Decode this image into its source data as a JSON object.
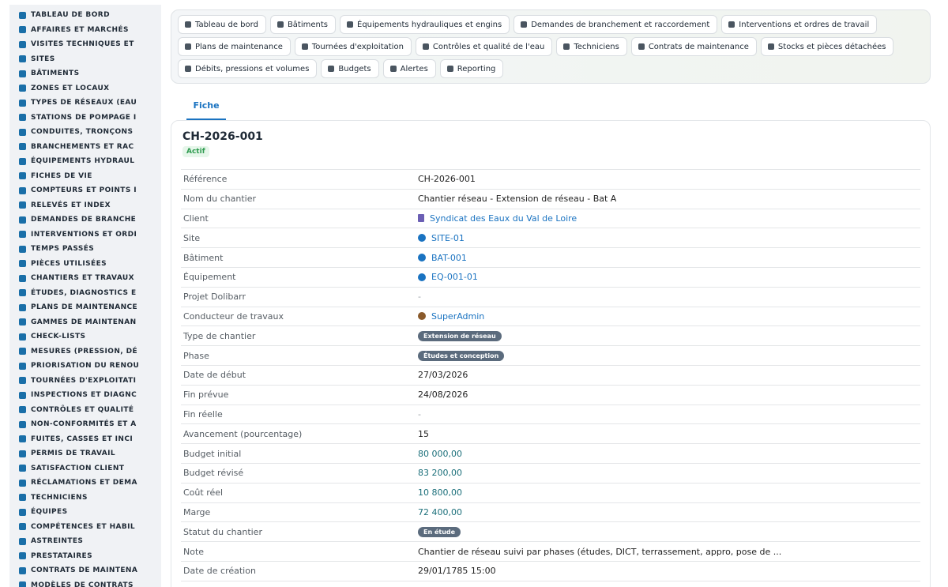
{
  "sidebar": {
    "items": [
      {
        "label": "TABLEAU DE BORD",
        "icon": "dashboard-icon"
      },
      {
        "label": "AFFAIRES ET MARCHÉS",
        "icon": "briefcase-icon"
      },
      {
        "label": "VISITES TECHNIQUES ET",
        "icon": "clipboard-icon"
      },
      {
        "label": "SITES",
        "icon": "map-pin-icon"
      },
      {
        "label": "BÂTIMENTS",
        "icon": "building-icon"
      },
      {
        "label": "ZONES ET LOCAUX",
        "icon": "layers-icon"
      },
      {
        "label": "TYPES DE RÉSEAUX (EAU",
        "icon": "network-icon"
      },
      {
        "label": "STATIONS DE POMPAGE I",
        "icon": "pump-icon"
      },
      {
        "label": "CONDUITES, TRONÇONS",
        "icon": "pipe-icon"
      },
      {
        "label": "BRANCHEMENTS ET RAC",
        "icon": "connection-icon"
      },
      {
        "label": "ÉQUIPEMENTS HYDRAUL",
        "icon": "gears-icon"
      },
      {
        "label": "FICHES DE VIE",
        "icon": "history-icon"
      },
      {
        "label": "COMPTEURS ET POINTS I",
        "icon": "gauge-icon"
      },
      {
        "label": "RELEVÉS ET INDEX",
        "icon": "list-icon"
      },
      {
        "label": "DEMANDES DE BRANCHE",
        "icon": "question-icon"
      },
      {
        "label": "INTERVENTIONS ET ORDI",
        "icon": "task-icon"
      },
      {
        "label": "TEMPS PASSÉS",
        "icon": "clock-icon"
      },
      {
        "label": "PIÈCES UTILISÉES",
        "icon": "parts-icon"
      },
      {
        "label": "CHANTIERS ET TRAVAUX",
        "icon": "hammer-icon"
      },
      {
        "label": "ÉTUDES, DIAGNOSTICS E",
        "icon": "book-icon"
      },
      {
        "label": "PLANS DE MAINTENANCE",
        "icon": "calendar-icon"
      },
      {
        "label": "GAMMES DE MAINTENAN",
        "icon": "list-ordered-icon"
      },
      {
        "label": "CHECK-LISTS",
        "icon": "checklist-icon"
      },
      {
        "label": "MESURES (PRESSION, DÉ",
        "icon": "thermometer-icon"
      },
      {
        "label": "PRIORISATION DU RENOU",
        "icon": "chart-icon"
      },
      {
        "label": "TOURNÉES D'EXPLOITATI",
        "icon": "route-icon"
      },
      {
        "label": "INSPECTIONS ET DIAGNC",
        "icon": "search-icon"
      },
      {
        "label": "CONTRÔLES ET QUALITÉ",
        "icon": "clipboard-check-icon"
      },
      {
        "label": "NON-CONFORMITÉS ET A",
        "icon": "alert-circle-icon"
      },
      {
        "label": "FUITES, CASSES ET INCI",
        "icon": "warning-icon"
      },
      {
        "label": "PERMIS DE TRAVAIL",
        "icon": "permit-icon"
      },
      {
        "label": "SATISFACTION CLIENT",
        "icon": "smile-icon"
      },
      {
        "label": "RÉCLAMATIONS ET DEMA",
        "icon": "message-icon"
      },
      {
        "label": "TECHNICIENS",
        "icon": "hardhat-icon"
      },
      {
        "label": "ÉQUIPES",
        "icon": "users-icon"
      },
      {
        "label": "COMPÉTENCES ET HABIL",
        "icon": "certificate-icon"
      },
      {
        "label": "ASTREINTES",
        "icon": "phone-icon"
      },
      {
        "label": "PRESTATAIRES",
        "icon": "handshake-icon"
      },
      {
        "label": "CONTRATS DE MAINTENA",
        "icon": "contract-icon"
      },
      {
        "label": "MODÈLES DE CONTRATS",
        "icon": "template-icon"
      }
    ]
  },
  "topnav": {
    "row1": [
      {
        "label": "Tableau de bord",
        "icon": "dashboard-icon"
      },
      {
        "label": "Bâtiments",
        "icon": "building-icon"
      },
      {
        "label": "Équipements hydrauliques et engins",
        "icon": "gears-icon"
      },
      {
        "label": "Demandes de branchement et raccordement",
        "icon": "question-icon"
      },
      {
        "label": "Interventions et ordres de travail",
        "icon": "task-icon"
      }
    ],
    "row2": [
      {
        "label": "Plans de maintenance",
        "icon": "calendar-icon"
      },
      {
        "label": "Tournées d'exploitation",
        "icon": "route-icon"
      },
      {
        "label": "Contrôles et qualité de l'eau",
        "icon": "clipboard-check-icon"
      },
      {
        "label": "Techniciens",
        "icon": "hardhat-icon"
      },
      {
        "label": "Contrats de maintenance",
        "icon": "contract-icon"
      },
      {
        "label": "Stocks et pièces détachées",
        "icon": "boxes-icon"
      }
    ],
    "row3": [
      {
        "label": "Débits, pressions et volumes",
        "icon": "bolt-icon"
      },
      {
        "label": "Budgets",
        "icon": "money-icon"
      },
      {
        "label": "Alertes",
        "icon": "bell-icon"
      },
      {
        "label": "Reporting",
        "icon": "pie-chart-icon"
      }
    ]
  },
  "tabs": {
    "fiche": "Fiche"
  },
  "record": {
    "title": "CH-2026-001",
    "status": "Actif",
    "rows": [
      {
        "label": "Référence",
        "value": "CH-2026-001",
        "kind": "text"
      },
      {
        "label": "Nom du chantier",
        "value": "Chantier réseau - Extension de réseau - Bat A",
        "kind": "text"
      },
      {
        "label": "Client",
        "value": "Syndicat des Eaux du Val de Loire",
        "kind": "link",
        "icon": "building-icon"
      },
      {
        "label": "Site",
        "value": "SITE-01",
        "kind": "link",
        "icon": "water-drop-icon"
      },
      {
        "label": "Bâtiment",
        "value": "BAT-001",
        "kind": "link",
        "icon": "water-drop-icon"
      },
      {
        "label": "Équipement",
        "value": "EQ-001-01",
        "kind": "link",
        "icon": "water-drop-icon"
      },
      {
        "label": "Projet Dolibarr",
        "value": "-",
        "kind": "muted"
      },
      {
        "label": "Conducteur de travaux",
        "value": "SuperAdmin",
        "kind": "link",
        "icon": "user-icon"
      },
      {
        "label": "Type de chantier",
        "value": "Extension de réseau",
        "kind": "badge"
      },
      {
        "label": "Phase",
        "value": "Études et conception",
        "kind": "badge"
      },
      {
        "label": "Date de début",
        "value": "27/03/2026",
        "kind": "text"
      },
      {
        "label": "Fin prévue",
        "value": "24/08/2026",
        "kind": "text"
      },
      {
        "label": "Fin réelle",
        "value": "-",
        "kind": "muted"
      },
      {
        "label": "Avancement (pourcentage)",
        "value": "15",
        "kind": "text"
      },
      {
        "label": "Budget initial",
        "value": "80 000,00",
        "kind": "money"
      },
      {
        "label": "Budget révisé",
        "value": "83 200,00",
        "kind": "money"
      },
      {
        "label": "Coût réel",
        "value": "10 800,00",
        "kind": "money"
      },
      {
        "label": "Marge",
        "value": "72 400,00",
        "kind": "money"
      },
      {
        "label": "Statut du chantier",
        "value": "En étude",
        "kind": "badge"
      },
      {
        "label": "Note",
        "value": "Chantier de réseau suivi par phases (études, DICT, terrassement, appro, pose de ...",
        "kind": "text"
      },
      {
        "label": "Date de création",
        "value": "29/01/1785 15:00",
        "kind": "text"
      }
    ]
  }
}
